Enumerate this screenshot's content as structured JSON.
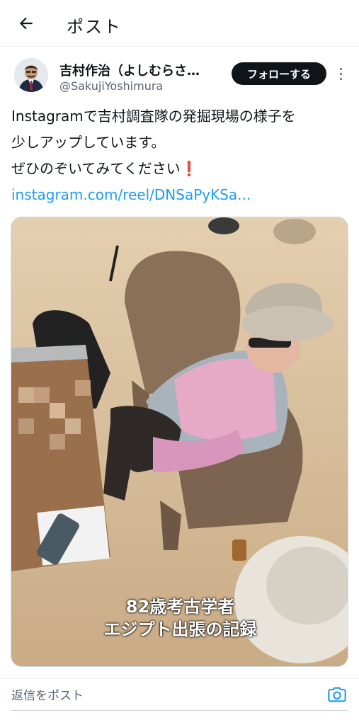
{
  "header": {
    "back_icon": "arrow-left-icon",
    "title": "ポスト"
  },
  "author": {
    "name": "吉村作治（よしむらさ…",
    "handle": "@SakujiYoshimura",
    "follow_label": "フォローする",
    "more_icon": "more-vertical-icon"
  },
  "post": {
    "lines": [
      "Instagramで吉村調査隊の発掘現場の様子を",
      "少しアップしています。",
      "ぜひのぞいてみてください"
    ],
    "emoji": "❗",
    "link": "instagram.com/reel/DNSaPyKSa..."
  },
  "media": {
    "caption_line1": "82歳考古学者",
    "caption_line2": "エジプト出張の記録"
  },
  "reply": {
    "placeholder": "返信をポスト",
    "camera_icon": "camera-icon"
  },
  "colors": {
    "accent": "#1d9bf0",
    "text": "#0f1419",
    "secondary": "#536471",
    "follow_bg": "#0f1419"
  }
}
